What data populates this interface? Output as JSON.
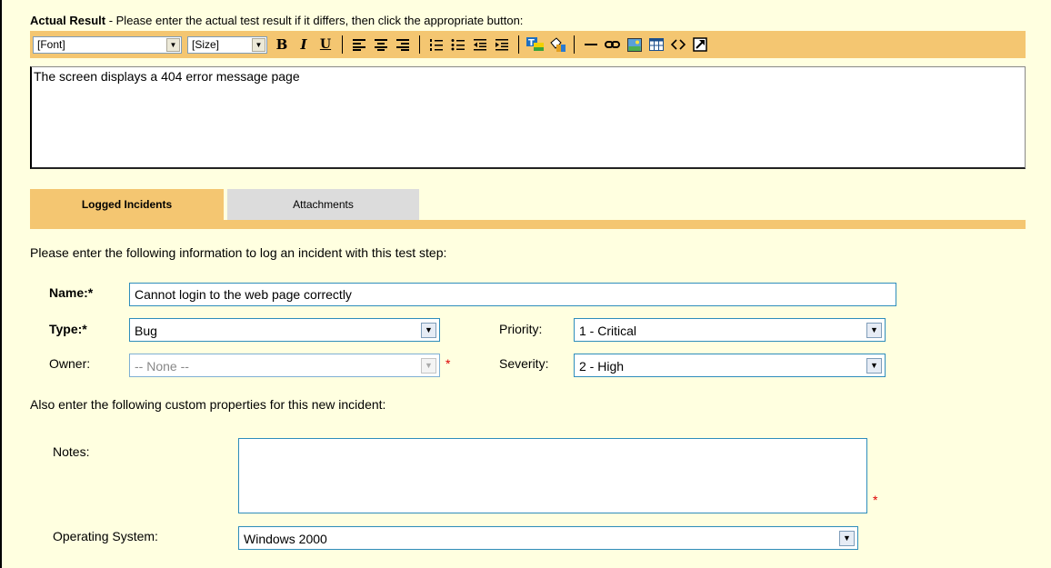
{
  "actual_result": {
    "title": "Actual Result",
    "instruction": " - Please enter the actual test result if it differs, then click the appropriate button:",
    "text": "The screen displays a 404 error message page"
  },
  "toolbar": {
    "font_value": "[Font]",
    "size_value": "[Size]",
    "bold_icon": "bold-icon",
    "italic_icon": "italic-icon",
    "underline_icon": "underline-icon"
  },
  "tabs": {
    "active": "Logged Incidents",
    "inactive": "Attachments"
  },
  "incident_form": {
    "intro": "Please enter the following information to log an incident with this test step:",
    "name_label": "Name:*",
    "name_value": "Cannot login to the web page correctly",
    "type_label": "Type:*",
    "type_value": "Bug",
    "owner_label": "Owner:",
    "owner_value": "-- None --",
    "priority_label": "Priority:",
    "priority_value": "1 - Critical",
    "severity_label": "Severity:",
    "severity_value": "2 - High",
    "required_star": "*"
  },
  "custom_properties": {
    "intro": "Also enter the following custom properties for this new incident:",
    "notes_label": "Notes:",
    "notes_value": "",
    "os_label": "Operating System:",
    "os_value": "Windows 2000"
  },
  "colors": {
    "toolbar_bg": "#f4c671",
    "page_bg": "#ffffe0",
    "input_border": "#2e8dbb",
    "required": "#dd0000"
  }
}
